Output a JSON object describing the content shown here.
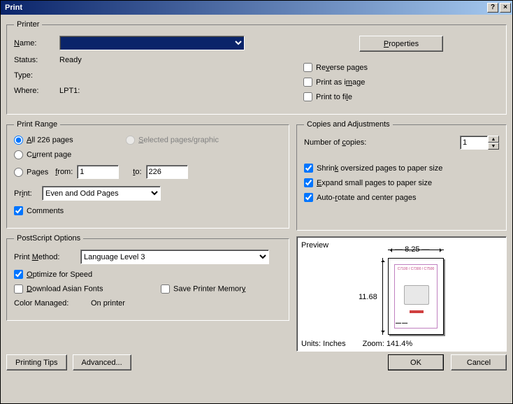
{
  "window": {
    "title": "Print"
  },
  "printer": {
    "legend": "Printer",
    "name_label": "Name:",
    "name_value": "",
    "properties_btn": "Properties",
    "status_label": "Status:",
    "status_value": "Ready",
    "type_label": "Type:",
    "type_value": "",
    "where_label": "Where:",
    "where_value": "LPT1:",
    "reverse_pages": "Reverse pages",
    "print_as_image": "Print as image",
    "print_to_file": "Print to file"
  },
  "range": {
    "legend": "Print Range",
    "all_pages": "All 226 pages",
    "selected": "Selected pages/graphic",
    "current": "Current page",
    "pages": "Pages",
    "from_label": "from:",
    "from_value": "1",
    "to_label": "to:",
    "to_value": "226",
    "print_label": "Print:",
    "print_value": "Even and Odd Pages",
    "comments": "Comments"
  },
  "copies": {
    "legend": "Copies and Adjustments",
    "num_label": "Number of copies:",
    "num_value": "1",
    "shrink": "Shrink oversized pages to paper size",
    "expand": "Expand small pages to paper size",
    "autorotate": "Auto-rotate and center pages"
  },
  "postscript": {
    "legend": "PostScript Options",
    "method_label": "Print Method:",
    "method_value": "Language Level 3",
    "optimize": "Optimize for Speed",
    "download_asian": "Download Asian Fonts",
    "save_mem": "Save Printer Memory",
    "color_managed_label": "Color Managed:",
    "color_managed_value": "On printer"
  },
  "preview": {
    "label": "Preview",
    "width": "8.25",
    "height": "11.68",
    "units": "Units: Inches",
    "zoom": "Zoom: 141.4%"
  },
  "buttons": {
    "tips": "Printing Tips",
    "advanced": "Advanced...",
    "ok": "OK",
    "cancel": "Cancel"
  }
}
